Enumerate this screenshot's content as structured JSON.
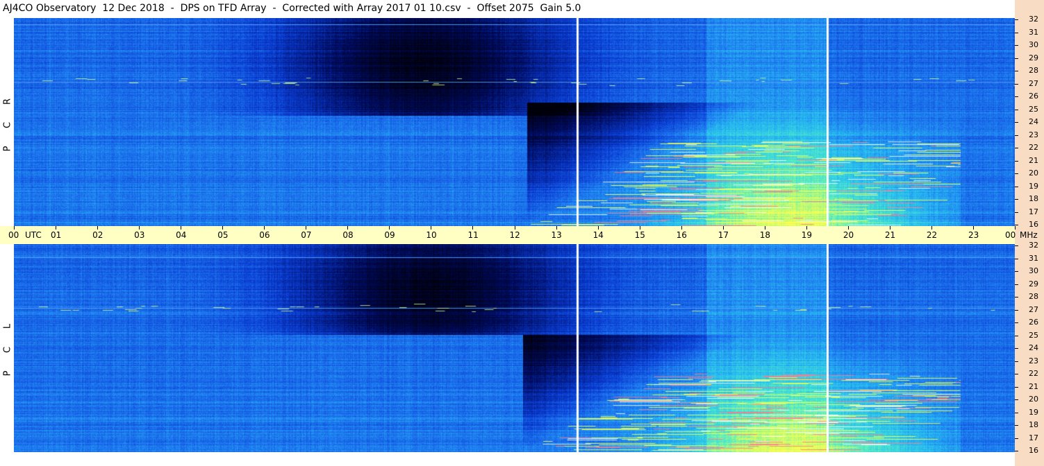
{
  "title": "AJ4CO Observatory  12 Dec 2018  -  DPS on TFD Array  -  Corrected with Array 2017 01 10.csv  -  Offset 2075  Gain 5.0",
  "colors": {
    "axis_band": "#ffffc4",
    "right_strip": "#f8dcc4",
    "background": "#ffffff"
  },
  "chart_data": [
    {
      "type": "heatmap",
      "name": "RCP",
      "polarization_label": [
        "R",
        "C",
        "P"
      ],
      "x_unit": "UTC hour",
      "y_unit": "MHz",
      "x_range": [
        0,
        24
      ],
      "y_range": [
        16,
        32
      ],
      "x_ticks": [
        "00",
        "01",
        "02",
        "03",
        "04",
        "05",
        "06",
        "07",
        "08",
        "09",
        "10",
        "11",
        "12",
        "13",
        "14",
        "15",
        "16",
        "17",
        "18",
        "19",
        "20",
        "21",
        "22",
        "23",
        "00"
      ],
      "y_ticks": [
        32,
        31,
        30,
        29,
        28,
        27,
        26,
        25,
        24,
        23,
        22,
        21,
        20,
        19,
        18,
        17,
        16
      ],
      "vertical_markers_utc": [
        13.5,
        19.5
      ],
      "horizontal_lines_mhz": [
        31.5,
        27.1
      ],
      "emission": {
        "start_utc": 12.3,
        "end_utc": 22.7,
        "fmin": 16,
        "fmax": 22.5,
        "peak_utc": 18.8
      },
      "dark_region": {
        "center_utc": 9.8,
        "fmin": 24.5,
        "fmax": 32
      }
    },
    {
      "type": "heatmap",
      "name": "LCP",
      "polarization_label": [
        "L",
        "C",
        "P"
      ],
      "x_unit": "UTC hour",
      "y_unit": "MHz",
      "x_range": [
        0,
        24
      ],
      "y_range": [
        16,
        32
      ],
      "y_ticks": [
        32,
        31,
        30,
        29,
        28,
        27,
        26,
        25,
        24,
        23,
        22,
        21,
        20,
        19,
        18,
        17,
        16
      ],
      "vertical_markers_utc": [
        13.5,
        19.5
      ],
      "horizontal_lines_mhz": [
        31.0,
        27.1
      ],
      "emission": {
        "start_utc": 12.2,
        "end_utc": 22.7,
        "fmin": 16,
        "fmax": 22.0,
        "peak_utc": 18.8
      },
      "dark_region": {
        "center_utc": 10.0,
        "fmin": 25.0,
        "fmax": 31.5
      }
    }
  ],
  "time_axis": {
    "labels": [
      "00",
      "01",
      "02",
      "03",
      "04",
      "05",
      "06",
      "07",
      "08",
      "09",
      "10",
      "11",
      "12",
      "13",
      "14",
      "15",
      "16",
      "17",
      "18",
      "19",
      "20",
      "21",
      "22",
      "23",
      "00"
    ],
    "utc_label": "UTC",
    "unit_label": "MHz"
  }
}
